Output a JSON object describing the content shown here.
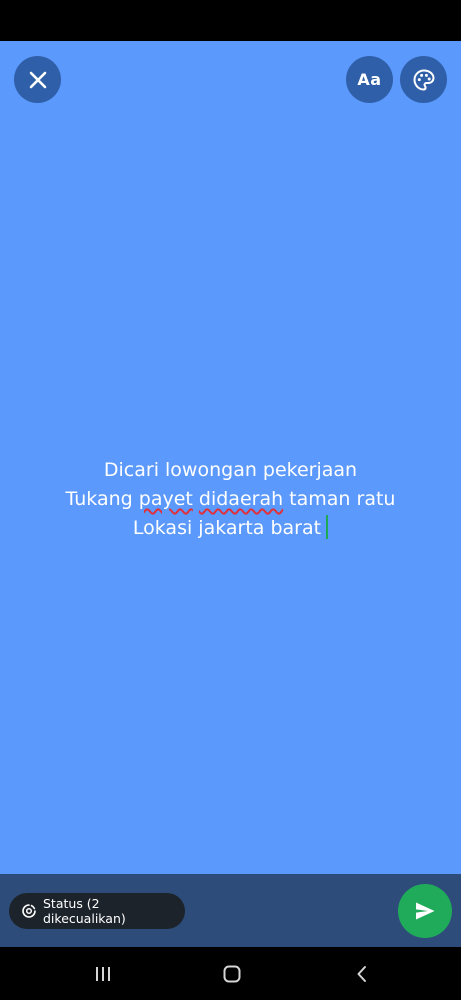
{
  "colors": {
    "canvas_background": "#5b99fc",
    "round_button": "#2f5fa8",
    "bottom_bar": "#2e4c7a",
    "send_button": "#1fab5a",
    "caret": "#1fa855",
    "spellcheck_underline": "#e0303a"
  },
  "toolbar": {
    "close_icon": "close-icon",
    "font_label": "Aa",
    "palette_icon": "palette-icon"
  },
  "status_text": {
    "line1": "Dicari lowongan pekerjaan",
    "line2": {
      "part1": "Tukang ",
      "misspelled1": "payet",
      "space": " ",
      "misspelled2": "didaerah",
      "part2": " taman ratu"
    },
    "line3": "Lokasi jakarta barat"
  },
  "footer": {
    "audience_label": "Status (2 dikecualikan)",
    "audience_icon": "status-ring-icon",
    "send_icon": "send-icon"
  },
  "navigation": {
    "recent_icon": "recent-apps-icon",
    "home_icon": "home-icon",
    "back_icon": "back-icon"
  }
}
